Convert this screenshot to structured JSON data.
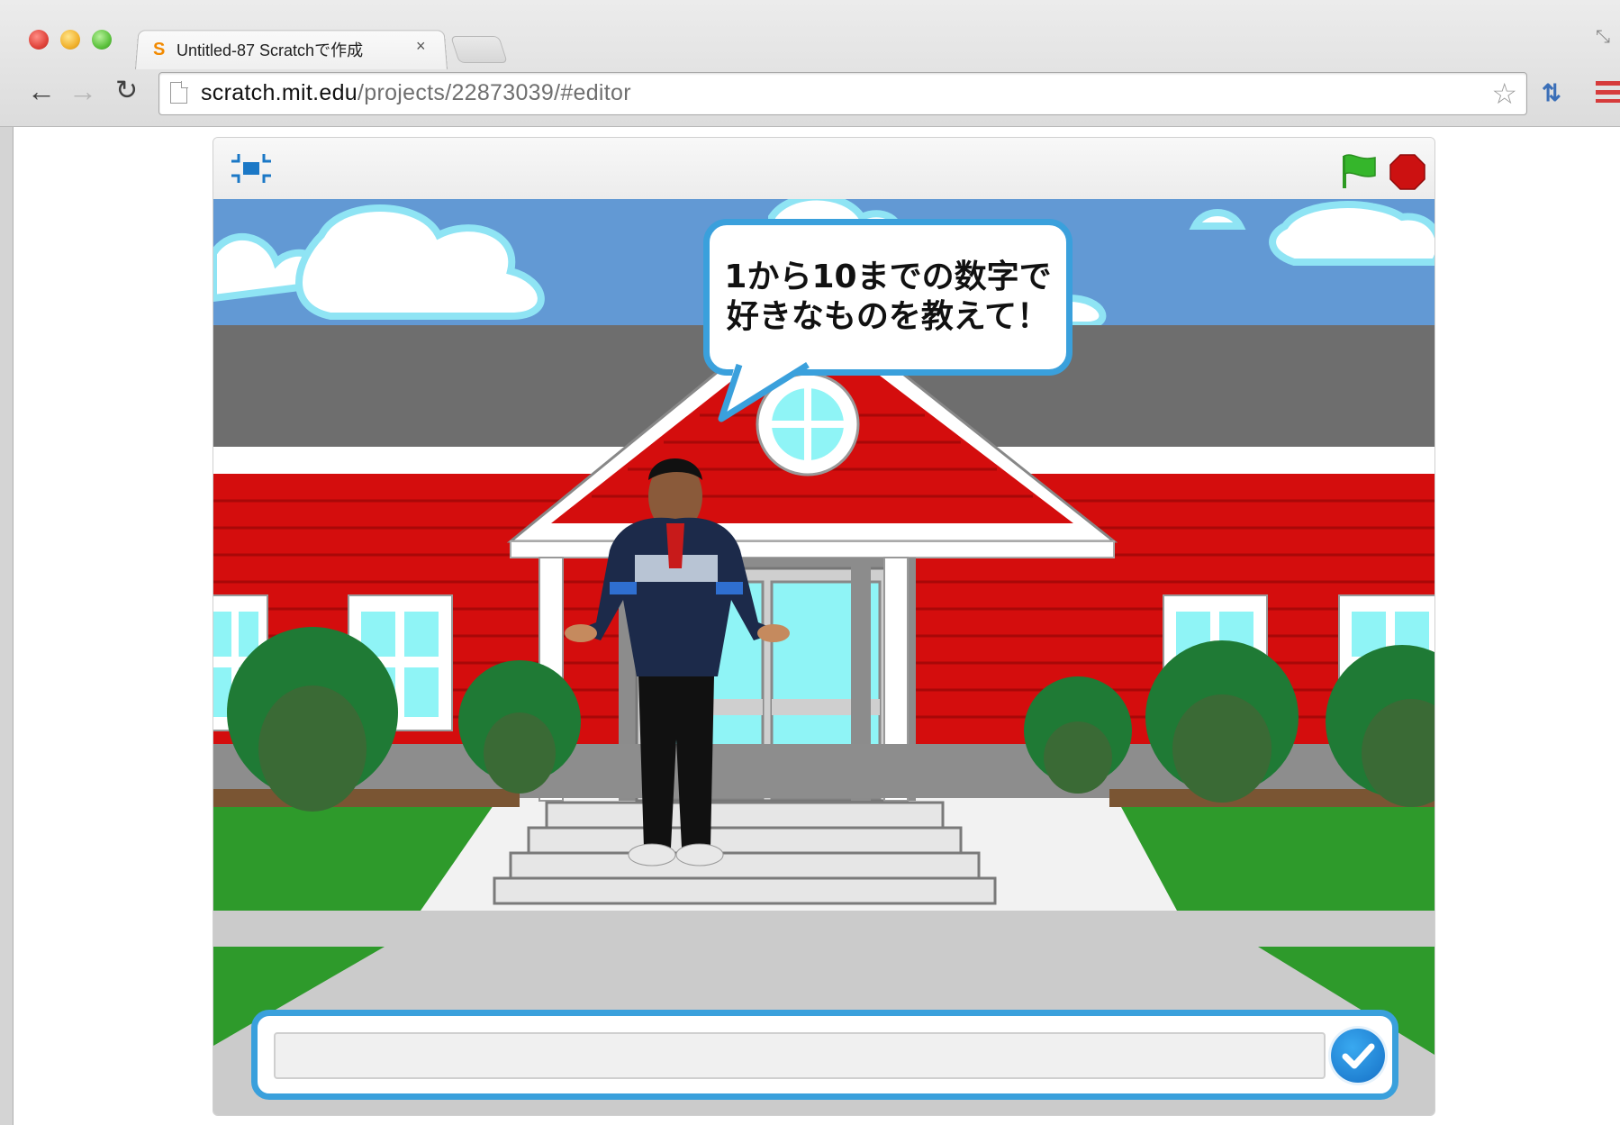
{
  "browser": {
    "tab_title": "Untitled-87 Scratchで作成",
    "tab_favicon": "S",
    "tab_close": "×",
    "url_host": "scratch.mit.edu",
    "url_path": "/projects/22873039/#editor",
    "nav": {
      "back": "←",
      "forward": "→",
      "reload": "↻"
    },
    "bookmark_star": "☆",
    "extension_icon": "⇅",
    "icons": [
      "close-window-icon",
      "minimize-window-icon",
      "zoom-window-icon",
      "back-arrow-icon",
      "forward-arrow-icon",
      "reload-icon",
      "page-icon",
      "bookmark-star-icon",
      "extension-icon",
      "chrome-menu-icon",
      "fullscreen-resize-icon"
    ]
  },
  "player": {
    "icons": [
      "fullscreen-toggle-icon",
      "green-flag-icon",
      "stop-sign-icon"
    ],
    "colors": {
      "flag": "#35b62b",
      "stop": "#cc1111",
      "accent": "#3aa0dc"
    },
    "speech_bubble": "1から10までの数字で好きなものを教えて！",
    "ask_input_value": "",
    "ask_submit_icon": "checkmark-icon"
  }
}
